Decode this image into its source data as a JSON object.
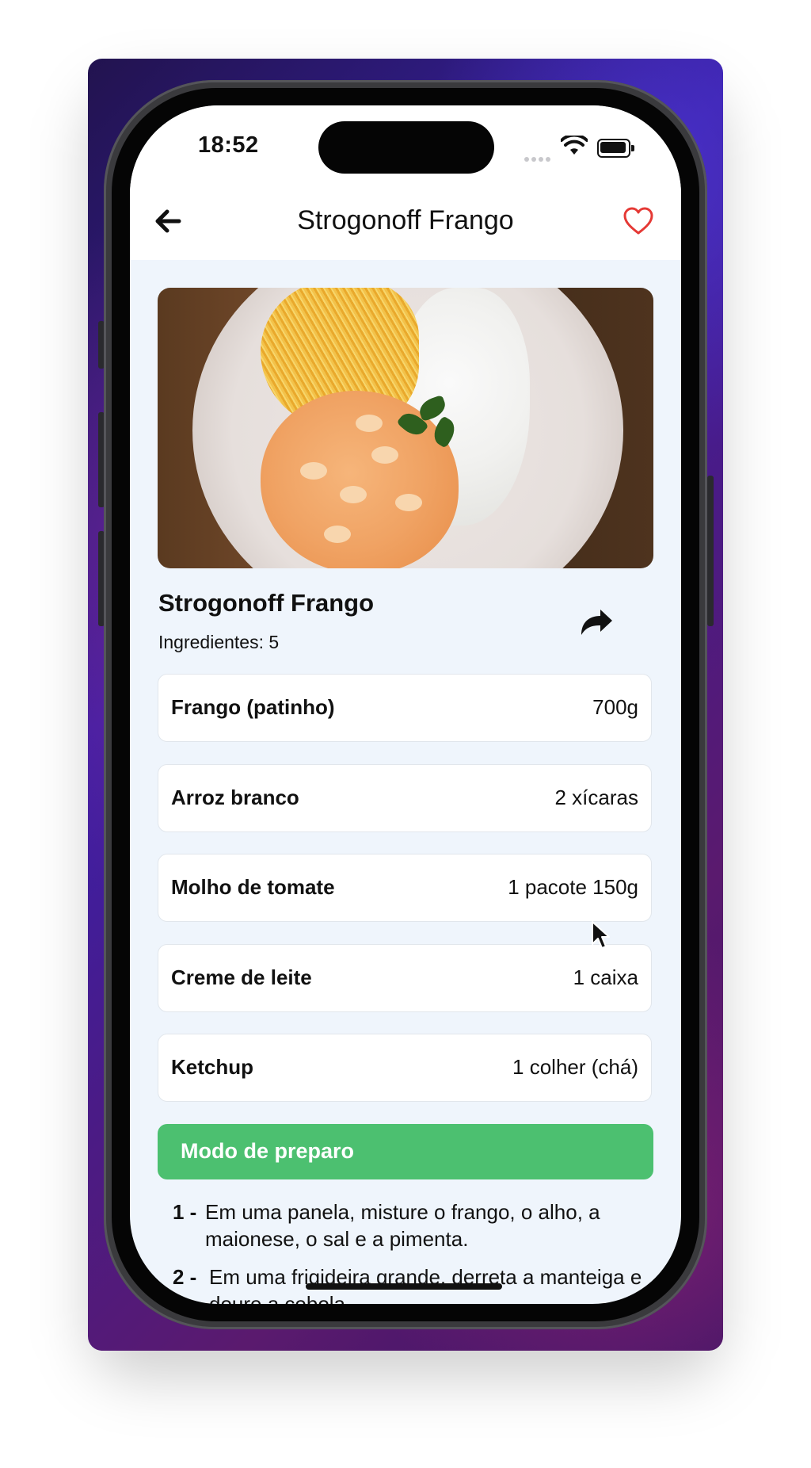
{
  "status_bar": {
    "time": "18:52"
  },
  "header": {
    "title": "Strogonoff Frango"
  },
  "recipe": {
    "title": "Strogonoff Frango",
    "ingredients_count": "Ingredientes: 5",
    "ingredients": [
      {
        "name": "Frango (patinho)",
        "qty": "700g"
      },
      {
        "name": "Arroz branco",
        "qty": "2 xícaras"
      },
      {
        "name": "Molho de tomate",
        "qty": "1 pacote 150g"
      },
      {
        "name": "Creme de leite",
        "qty": "1 caixa"
      },
      {
        "name": "Ketchup",
        "qty": "1 colher (chá)"
      }
    ],
    "prep_button": "Modo de preparo",
    "steps": [
      {
        "num": "1 -",
        "text": "Em uma panela, misture o frango, o alho, a maionese, o sal e a pimenta."
      },
      {
        "num": "2 -",
        "text": "Em uma frigideira grande, derreta a manteiga e doure a cebola."
      }
    ]
  },
  "colors": {
    "accent_green": "#4cc070",
    "heart_red": "#e53935",
    "background": "#eff5fc"
  },
  "icons": [
    "back-arrow-icon",
    "heart-icon",
    "share-icon",
    "wifi-icon",
    "battery-icon",
    "cursor-icon"
  ]
}
